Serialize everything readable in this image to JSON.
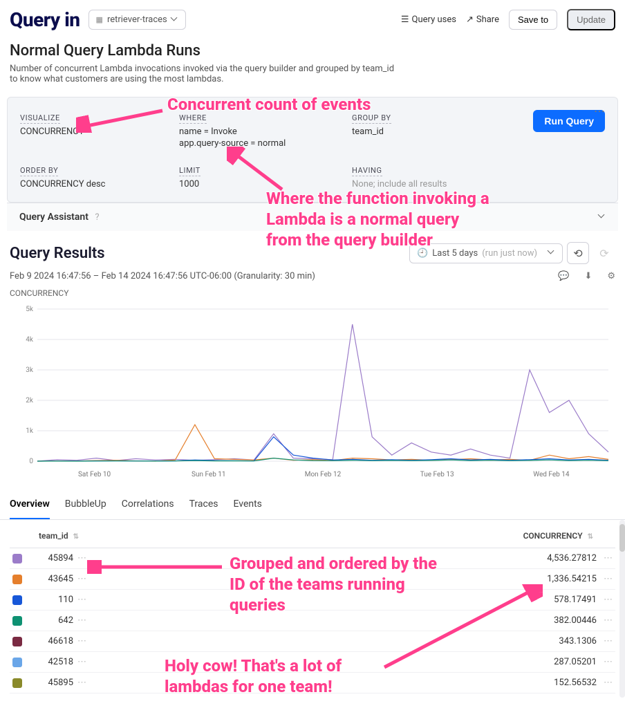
{
  "header": {
    "brand": "Query in",
    "dataset": "retriever-traces",
    "queryUses": "Query uses",
    "share": "Share",
    "saveTo": "Save to",
    "update": "Update"
  },
  "page": {
    "title": "Normal Query Lambda Runs",
    "desc": "Number of concurrent Lambda invocations invoked via the query builder and grouped by team_id to know what customers are using the most lambdas."
  },
  "query": {
    "visualizeLabel": "VISUALIZE",
    "visualizeVal": "CONCURRENCY",
    "whereLabel": "WHERE",
    "whereVal1": "name = Invoke",
    "whereVal2": "app.query-source = normal",
    "groupByLabel": "GROUP BY",
    "groupByVal": "team_id",
    "orderByLabel": "ORDER BY",
    "orderByVal": "CONCURRENCY desc",
    "limitLabel": "LIMIT",
    "limitVal": "1000",
    "havingLabel": "HAVING",
    "havingVal": "None; include all results",
    "runBtn": "Run Query",
    "assistant": "Query Assistant"
  },
  "results": {
    "title": "Query Results",
    "timeLabel": "Last 5 days",
    "timeSub": "(run just now)",
    "range": "Feb 9 2024 16:47:56 – Feb 14 2024 16:47:56 UTC-06:00 (Granularity: 30 min)",
    "chartLabel": "CONCURRENCY"
  },
  "tabs": {
    "overview": "Overview",
    "bubbleup": "BubbleUp",
    "correlations": "Correlations",
    "traces": "Traces",
    "events": "Events"
  },
  "table": {
    "col1": "team_id",
    "col2": "CONCURRENCY",
    "rows": [
      {
        "id": "45894",
        "conc": "4,536.27812",
        "color": "#9b7cc9"
      },
      {
        "id": "43645",
        "conc": "1,336.54215",
        "color": "#e57f2c"
      },
      {
        "id": "110",
        "conc": "578.17491",
        "color": "#1757d8"
      },
      {
        "id": "642",
        "conc": "382.00446",
        "color": "#0e9172"
      },
      {
        "id": "46618",
        "conc": "343.1306",
        "color": "#7a2a42"
      },
      {
        "id": "42518",
        "conc": "287.05201",
        "color": "#6aa6e8"
      },
      {
        "id": "45895",
        "conc": "152.56532",
        "color": "#8a8a2a"
      }
    ]
  },
  "anno": {
    "a1": "Concurrent count of events",
    "a2": "Where the function invoking a\nLambda is a normal query\nfrom the query builder",
    "a3": "Grouped and ordered by the\nID of the teams running\nqueries",
    "a4": "Holy cow! That's a lot of\nlambdas for one team!"
  },
  "chart_data": {
    "type": "line",
    "xlabel": "",
    "ylabel": "",
    "ylim": [
      0,
      5000
    ],
    "yticks": [
      "0",
      "1k",
      "2k",
      "3k",
      "4k",
      "5k"
    ],
    "xticks": [
      "Sat Feb 10",
      "Sun Feb 11",
      "Mon Feb 12",
      "Tue Feb 13",
      "Wed Feb 14"
    ],
    "series": [
      {
        "name": "45894",
        "color": "#9b7cc9",
        "values": [
          0,
          50,
          30,
          100,
          20,
          80,
          40,
          60,
          30,
          50,
          80,
          40,
          900,
          100,
          80,
          50,
          4500,
          800,
          200,
          600,
          300,
          200,
          400,
          200,
          100,
          3000,
          1600,
          2000,
          900,
          300
        ]
      },
      {
        "name": "43645",
        "color": "#e57f2c",
        "values": [
          0,
          10,
          5,
          20,
          30,
          10,
          0,
          40,
          1200,
          80,
          60,
          40,
          100,
          30,
          50,
          20,
          100,
          80,
          40,
          60,
          30,
          50,
          80,
          40,
          60,
          30,
          200,
          80,
          150,
          60
        ]
      },
      {
        "name": "110",
        "color": "#1757d8",
        "values": [
          0,
          5,
          2,
          8,
          12,
          6,
          3,
          10,
          40,
          20,
          15,
          10,
          800,
          200,
          100,
          40,
          60,
          30,
          50,
          30,
          50,
          80,
          40,
          60,
          30,
          50,
          80,
          40,
          60,
          30
        ]
      },
      {
        "name": "642",
        "color": "#0e9172",
        "values": [
          0,
          3,
          1,
          5,
          8,
          4,
          2,
          6,
          20,
          10,
          8,
          6,
          100,
          40,
          20,
          15,
          30,
          15,
          25,
          15,
          25,
          40,
          20,
          30,
          15,
          25,
          40,
          20,
          30,
          15
        ]
      }
    ]
  }
}
